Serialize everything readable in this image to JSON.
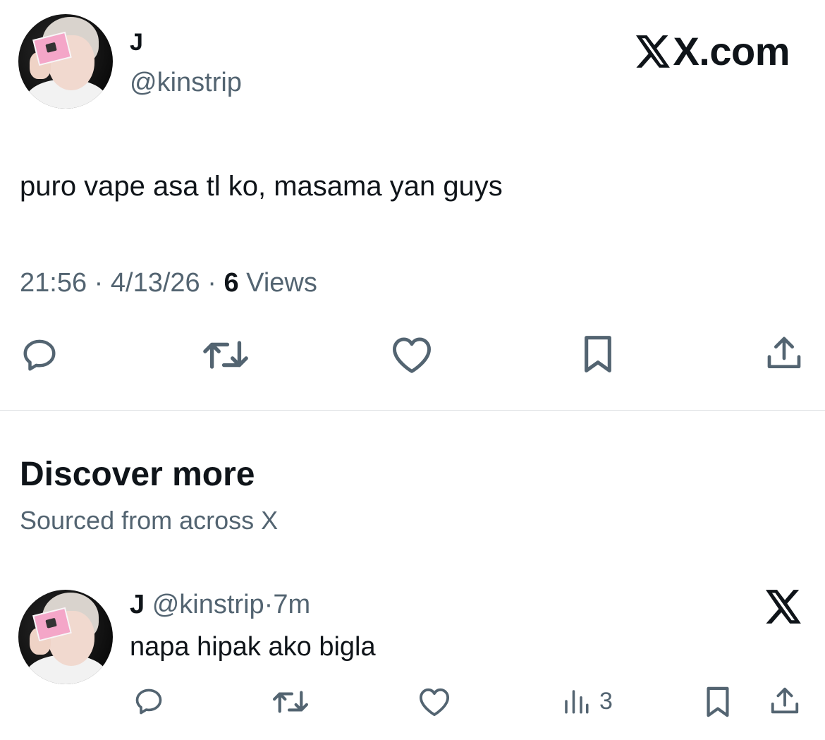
{
  "tweet": {
    "author_name": "J",
    "author_handle": "@kinstrip",
    "brand": "X.com",
    "text": "puro vape asa tl ko, masama yan guys",
    "time": "21:56",
    "date": "4/13/26",
    "views_count": "6",
    "views_label": "Views",
    "separator": "·"
  },
  "discover": {
    "title": "Discover more",
    "subtitle": "Sourced from across X"
  },
  "card": {
    "author_name": "J",
    "author_handle": "@kinstrip",
    "separator": "·",
    "time": "7m",
    "text": "napa hipak ako bigla",
    "views": "3"
  },
  "icons": {
    "reply": "reply-icon",
    "repost": "repost-icon",
    "like": "like-icon",
    "bookmark": "bookmark-icon",
    "share": "share-icon",
    "views": "views-icon",
    "x_logo": "x-logo-icon"
  },
  "colors": {
    "text_primary": "#0f1419",
    "text_secondary": "#536471",
    "divider": "#dadde0",
    "background": "#ffffff"
  }
}
